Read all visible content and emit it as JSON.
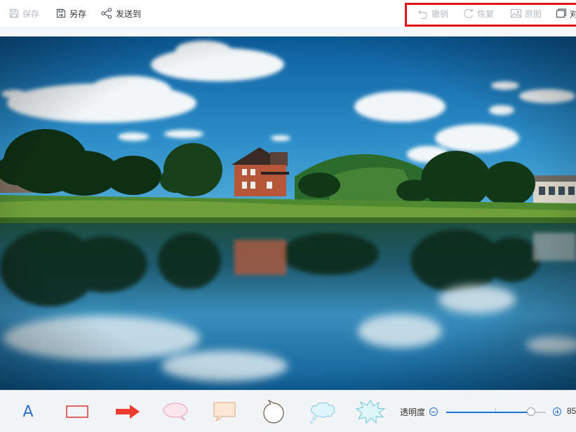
{
  "toolbar": {
    "save_label": "保存",
    "save_as_label": "另存",
    "send_to_label": "发送到",
    "undo_label": "撤销",
    "redo_label": "恢复",
    "original_label": "原图",
    "compare_label": "对"
  },
  "bottom_toolbar": {
    "text_tool_glyph": "A",
    "tools": [
      "text-icon",
      "rectangle-icon",
      "arrow-icon",
      "ellipse-bubble-icon",
      "rect-bubble-icon",
      "round-bubble-icon",
      "cloud-bubble-icon",
      "burst-bubble-icon"
    ],
    "opacity_label": "透明度",
    "opacity_value": "85",
    "opacity_percent": 85
  },
  "colors": {
    "highlight_border": "#e0141a",
    "accent_blue": "#1f72d8",
    "arrow_red": "#ef3b2d",
    "rect_stroke": "#d8383b",
    "ellipse_pink": "#f6c9d8",
    "bubble_orange": "#f6c8a6",
    "cloud_blue": "#cdeefa"
  }
}
